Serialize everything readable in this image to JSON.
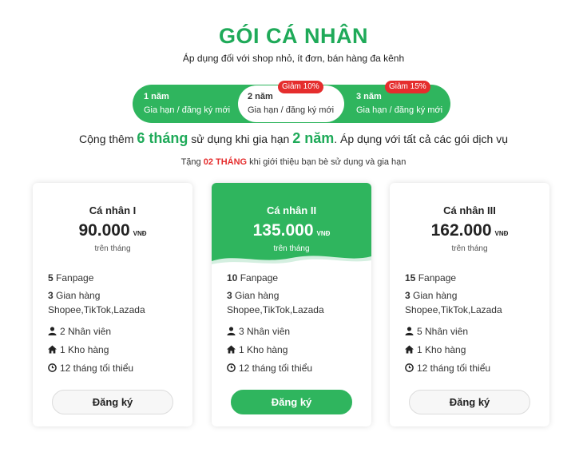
{
  "header": {
    "title": "GÓI CÁ NHÂN",
    "subtitle": "Áp dụng đối với shop nhỏ, ít đơn, bán hàng đa kênh"
  },
  "periods": [
    {
      "name": "1 năm",
      "desc": "Gia hạn / đăng ký mới",
      "badge": "",
      "selected": false
    },
    {
      "name": "2 năm",
      "desc": "Gia hạn / đăng ký mới",
      "badge": "Giảm 10%",
      "selected": true
    },
    {
      "name": "3 năm",
      "desc": "Gia hạn / đăng ký mới",
      "badge": "Giảm 15%",
      "selected": false
    }
  ],
  "promo": {
    "p1": "Cộng thêm ",
    "months": "6 tháng",
    "p2": " sử dụng khi gia hạn ",
    "years": "2 năm",
    "p3": ". Áp dụng với tất cả các gói dịch vụ"
  },
  "gift": {
    "p1": "Tặng ",
    "highlight": "02 THÁNG",
    "p2": " khi giới thiệu bạn bè sử dụng và gia hạn"
  },
  "plans": [
    {
      "name": "Cá nhân I",
      "price": "90.000",
      "unit": "VNĐ",
      "per": "trên tháng",
      "fanpage_count": "5",
      "fanpage_label": "Fanpage",
      "shops_count": "3",
      "shops_label": "Gian hàng",
      "shops_platforms": "Shopee,TikTok,Lazada",
      "staff": "2 Nhân viên",
      "warehouse": "1 Kho hàng",
      "duration": "12 tháng tối thiểu",
      "button": "Đăng ký",
      "highlighted": false
    },
    {
      "name": "Cá nhân II",
      "price": "135.000",
      "unit": "VNĐ",
      "per": "trên tháng",
      "fanpage_count": "10",
      "fanpage_label": "Fanpage",
      "shops_count": "3",
      "shops_label": "Gian hàng",
      "shops_platforms": "Shopee,TikTok,Lazada",
      "staff": "3 Nhân viên",
      "warehouse": "1 Kho hàng",
      "duration": "12 tháng tối thiểu",
      "button": "Đăng ký",
      "highlighted": true
    },
    {
      "name": "Cá nhân III",
      "price": "162.000",
      "unit": "VNĐ",
      "per": "trên tháng",
      "fanpage_count": "15",
      "fanpage_label": "Fanpage",
      "shops_count": "3",
      "shops_label": "Gian hàng",
      "shops_platforms": "Shopee,TikTok,Lazada",
      "staff": "5 Nhân viên",
      "warehouse": "1 Kho hàng",
      "duration": "12 tháng tối thiểu",
      "button": "Đăng ký",
      "highlighted": false
    }
  ],
  "icons": {
    "staff": "user-icon",
    "warehouse": "home-icon",
    "duration": "clock-icon"
  },
  "colors": {
    "brand_green": "#2fb55e",
    "title_green": "#1faa59",
    "discount_red": "#e52d2d"
  }
}
